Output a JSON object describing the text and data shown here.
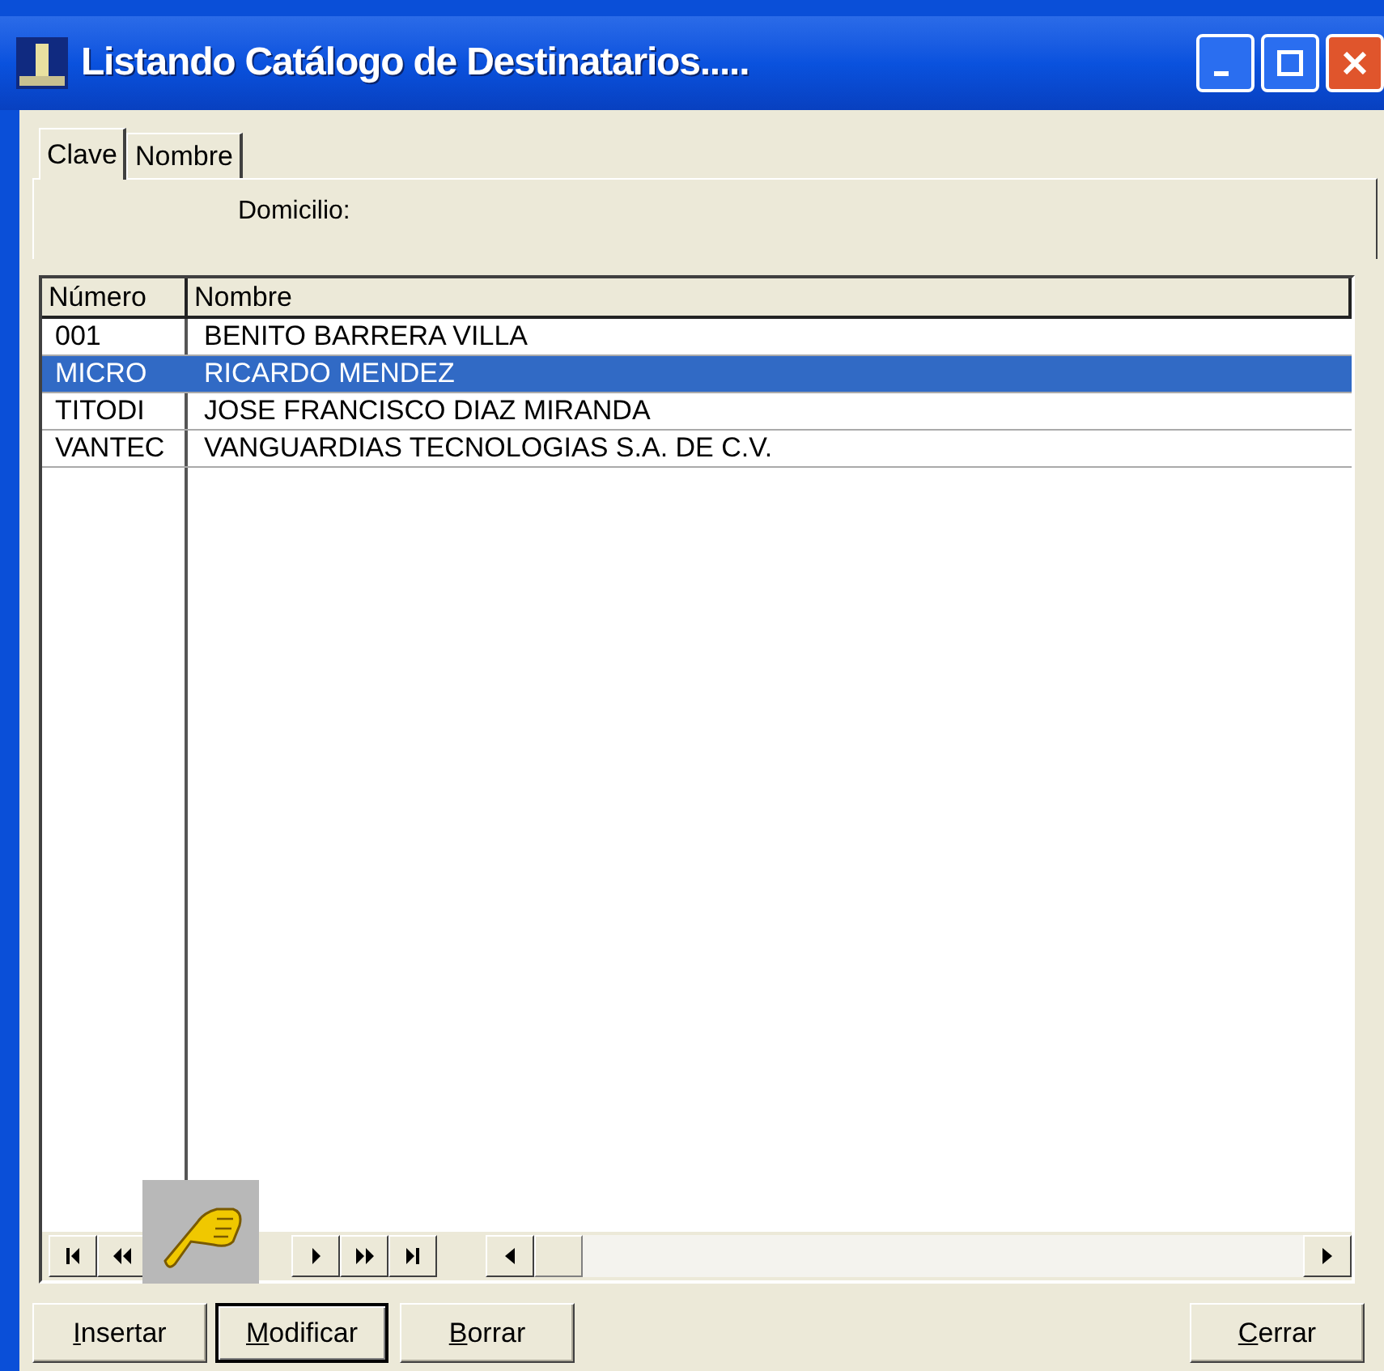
{
  "window": {
    "title": "Listando Catálogo de Destinatarios....."
  },
  "tabs": [
    {
      "label": "Clave",
      "selected": true
    },
    {
      "label": "Nombre",
      "selected": false
    }
  ],
  "domicilio_label": "Domicilio:",
  "table": {
    "columns": [
      "Número",
      "Nombre"
    ],
    "rows": [
      {
        "cells": [
          "001",
          "BENITO BARRERA VILLA"
        ],
        "selected": false
      },
      {
        "cells": [
          "MICRO",
          "RICARDO MENDEZ"
        ],
        "selected": true
      },
      {
        "cells": [
          "TITODI",
          "JOSE FRANCISCO DIAZ MIRANDA"
        ],
        "selected": false
      },
      {
        "cells": [
          "VANTEC",
          "VANGUARDIAS TECNOLOGIAS S.A. DE C.V."
        ],
        "selected": false
      }
    ]
  },
  "buttons": [
    {
      "label": "Insertar",
      "focused": false
    },
    {
      "label": "Modificar",
      "focused": true
    },
    {
      "label": "Borrar",
      "focused": false
    }
  ],
  "close_button": {
    "label": "Cerrar",
    "focused": false
  }
}
